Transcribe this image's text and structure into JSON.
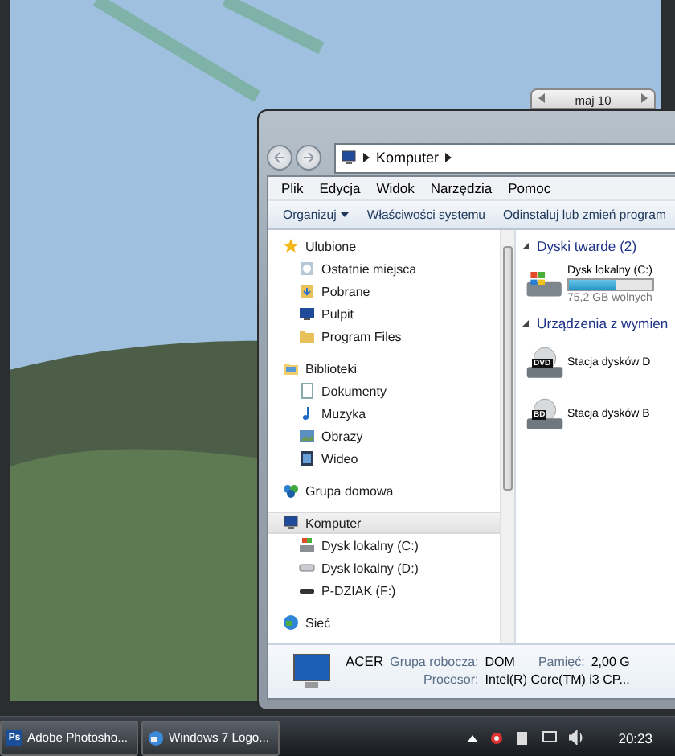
{
  "calendar_gadget": {
    "month": "maj 10"
  },
  "explorer": {
    "address": [
      "Komputer"
    ],
    "menu": [
      "Plik",
      "Edycja",
      "Widok",
      "Narzędzia",
      "Pomoc"
    ],
    "toolbar": [
      {
        "label": "Organizuj",
        "dropdown": true
      },
      {
        "label": "Właściwości systemu",
        "dropdown": false
      },
      {
        "label": "Odinstaluj lub zmień program",
        "dropdown": false
      }
    ],
    "nav": [
      {
        "label": "Ulubione",
        "kind": "star",
        "selected": false,
        "children": [
          {
            "label": "Ostatnie miejsca",
            "kind": "recent",
            "selected": false
          },
          {
            "label": "Pobrane",
            "kind": "download",
            "selected": false
          },
          {
            "label": "Pulpit",
            "kind": "desktop",
            "selected": false
          },
          {
            "label": "Program Files",
            "kind": "folder",
            "selected": false
          }
        ]
      },
      {
        "label": "Biblioteki",
        "kind": "library",
        "selected": false,
        "children": [
          {
            "label": "Dokumenty",
            "kind": "document",
            "selected": false
          },
          {
            "label": "Muzyka",
            "kind": "music",
            "selected": false
          },
          {
            "label": "Obrazy",
            "kind": "picture",
            "selected": false
          },
          {
            "label": "Wideo",
            "kind": "video",
            "selected": false
          }
        ]
      },
      {
        "label": "Grupa domowa",
        "kind": "homegroup",
        "selected": false
      },
      {
        "label": "Komputer",
        "kind": "computer",
        "selected": true,
        "children": [
          {
            "label": "Dysk lokalny (C:)",
            "kind": "windrive",
            "selected": false
          },
          {
            "label": "Dysk lokalny (D:)",
            "kind": "drive",
            "selected": false
          },
          {
            "label": "P-DZIAK (F:)",
            "kind": "usb",
            "selected": false
          }
        ]
      },
      {
        "label": "Sieć",
        "kind": "network",
        "selected": false
      }
    ],
    "groups": [
      {
        "title": "Dyski twarde (2)",
        "items": [
          {
            "kind": "hdd",
            "name": "Dysk lokalny (C:)",
            "level": 0.55,
            "free": "75,2 GB wolnych"
          }
        ]
      },
      {
        "title": "Urządzenia z wymien",
        "items": [
          {
            "kind": "optical",
            "badge": "DVD",
            "name": "Stacja dysków D"
          },
          {
            "kind": "optical",
            "badge": "BD",
            "name": "Stacja dysków B"
          }
        ]
      }
    ],
    "details": {
      "name": "ACER",
      "fields": [
        {
          "label": "Grupa robocza:",
          "value": "DOM"
        },
        {
          "label": "Pamięć:",
          "value": "2,00 G"
        },
        {
          "label": "Procesor:",
          "value": "Intel(R) Core(TM) i3 CP..."
        }
      ]
    }
  },
  "taskbar": {
    "buttons": [
      {
        "kind": "ps",
        "badge": "Ps",
        "label": "Adobe Photosho..."
      },
      {
        "kind": "globe",
        "label": "Windows 7 Logo..."
      }
    ],
    "clock": "20:23"
  }
}
